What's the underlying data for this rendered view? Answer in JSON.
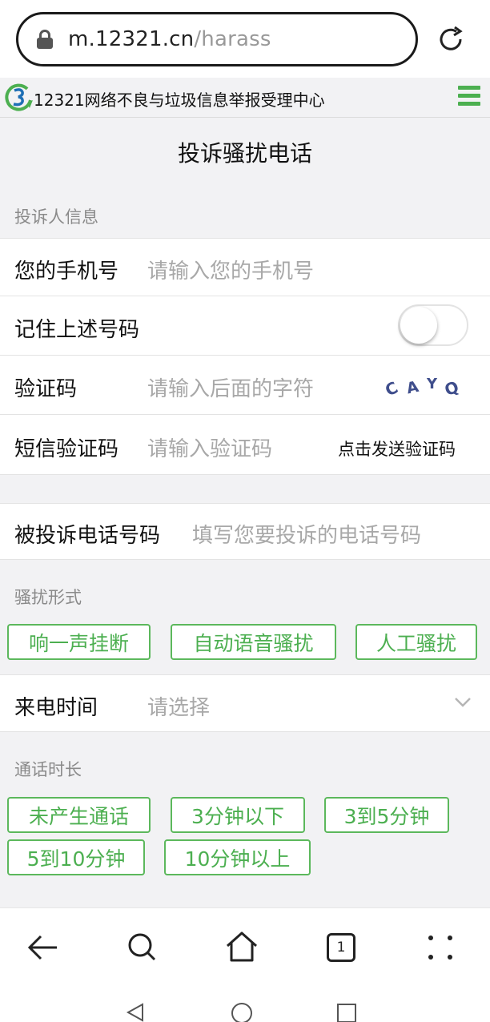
{
  "browser": {
    "url_host": "m.12321.cn",
    "url_path": "/harass"
  },
  "site": {
    "title": "12321网络不良与垃圾信息举报受理中心"
  },
  "page": {
    "title": "投诉骚扰电话"
  },
  "complainant": {
    "section_label": "投诉人信息",
    "phone_label": "您的手机号",
    "phone_placeholder": "请输入您的手机号",
    "remember_label": "记住上述号码",
    "remember_on": false,
    "captcha_label": "验证码",
    "captcha_placeholder": "请输入后面的字符",
    "captcha_chars": [
      "C",
      "A",
      "Y",
      "Q"
    ],
    "sms_label": "短信验证码",
    "sms_placeholder": "请输入验证码",
    "sms_button": "点击发送验证码"
  },
  "target": {
    "label": "被投诉电话号码",
    "placeholder": "填写您要投诉的电话号码"
  },
  "harass_form": {
    "section_label": "骚扰形式",
    "options": [
      "响一声挂断",
      "自动语音骚扰",
      "人工骚扰"
    ]
  },
  "call_time": {
    "label": "来电时间",
    "placeholder": "请选择"
  },
  "duration": {
    "section_label": "通话时长",
    "options": [
      "未产生通话",
      "3分钟以下",
      "3到5分钟",
      "5到10分钟",
      "10分钟以上"
    ]
  },
  "nav": {
    "tab_count": "1"
  },
  "colors": {
    "accent": "#4caf50",
    "placeholder": "#a8a8a8",
    "section": "#8a8a8a"
  }
}
